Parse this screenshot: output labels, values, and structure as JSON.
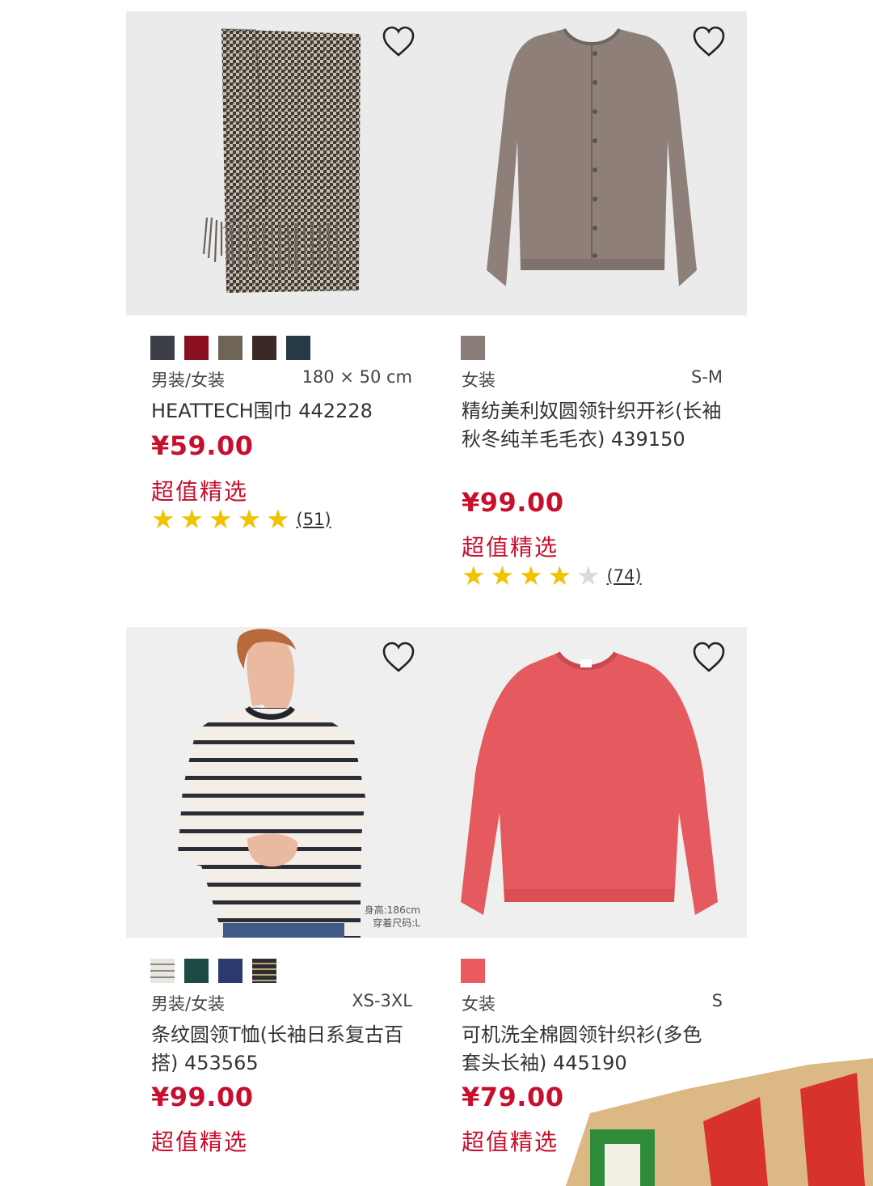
{
  "colors": {
    "price": "#c8102e",
    "star_on": "#f2c200",
    "star_off": "#dadada"
  },
  "products": [
    {
      "image": "houndstooth-scarf",
      "swatches": [
        "#3b3e47",
        "#8a1020",
        "#6e6558",
        "#3a2a25",
        "#253a45"
      ],
      "gender": "男装/女装",
      "size": "180 × 50 cm",
      "name": "HEATTECH围巾 442228",
      "price": "¥59.00",
      "tag": "超值精选",
      "rating": 5,
      "reviews": "(51)"
    },
    {
      "image": "taupe-cardigan",
      "swatches": [
        "#8a7d78"
      ],
      "gender": "女装",
      "size": "S-M",
      "name": "精纺美利奴圆领针织开衫(长袖秋冬纯羊毛毛衣) 439150",
      "price": "¥99.00",
      "tag": "超值精选",
      "rating": 4,
      "reviews": "(74)"
    },
    {
      "image": "striped-tshirt-model",
      "swatches": [
        "#e9e6e0",
        "#1d4a45",
        "#2b3a6e",
        "#2e2e2e"
      ],
      "gender": "男装/女装",
      "size": "XS-3XL",
      "name": "条纹圆领T恤(长袖日系复古百搭) 453565",
      "price": "¥99.00",
      "tag": "超值精选",
      "model_height": "身高:186cm",
      "model_size": "穿着尺码:L"
    },
    {
      "image": "red-sweater",
      "swatches": [
        "#ea5a5f"
      ],
      "gender": "女装",
      "size": "S",
      "name": "可机洗全棉圆领针织衫(多色 套头长袖) 445190",
      "price": "¥79.00",
      "tag": "超值精选"
    }
  ]
}
